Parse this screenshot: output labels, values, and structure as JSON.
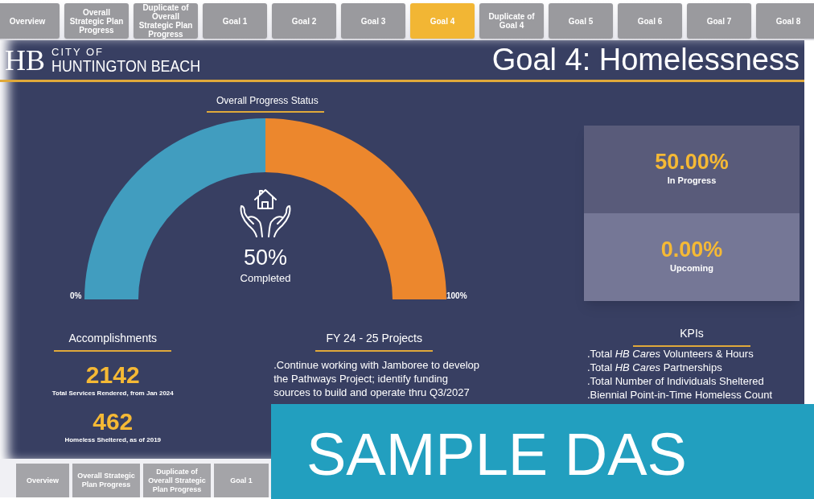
{
  "top_tabs": [
    {
      "label": "Overview",
      "selected": false
    },
    {
      "label": "Overall Strategic Plan Progress",
      "selected": false
    },
    {
      "label": "Duplicate of Overall Strategic Plan Progress",
      "selected": false
    },
    {
      "label": "Goal 1",
      "selected": false
    },
    {
      "label": "Goal 2",
      "selected": false
    },
    {
      "label": "Goal 3",
      "selected": false
    },
    {
      "label": "Goal 4",
      "selected": true
    },
    {
      "label": "Duplicate of Goal 4",
      "selected": false
    },
    {
      "label": "Goal 5",
      "selected": false
    },
    {
      "label": "Goal 6",
      "selected": false
    },
    {
      "label": "Goal 7",
      "selected": false
    },
    {
      "label": "Goal 8",
      "selected": false
    }
  ],
  "logo": {
    "mark": "HB",
    "small": "CITY OF",
    "large": "HUNTINGTON BEACH"
  },
  "title": "Goal 4: Homelessness",
  "gauge": {
    "title": "Overall Progress Status",
    "level": 0.5,
    "value": "50%",
    "caption": "Completed",
    "min_label": "0%",
    "max_label": "100%"
  },
  "status_cards": [
    {
      "value": "50.00%",
      "label": "In Progress"
    },
    {
      "value": "0.00%",
      "label": "Upcoming"
    }
  ],
  "accomplishments": {
    "title": "Accomplishments",
    "items": [
      {
        "value": "2142",
        "label": "Total Services Rendered, from Jan 2024"
      },
      {
        "value": "462",
        "label": "Homeless Sheltered, as of 2019"
      }
    ]
  },
  "projects": {
    "title": "FY 24 - 25 Projects",
    "items": [
      ".Continue working with Jamboree to develop the Pathways Project; identify funding sources to build and operate thru Q3/2027"
    ]
  },
  "kpis": {
    "title": "KPIs",
    "items": [
      ".Total *HB Cares* Volunteers & Hours",
      ".Total *HB Cares* Partnerships",
      ".Total Number of Individuals Sheltered",
      ".Biennial Point-in-Time Homeless Count"
    ]
  },
  "bottom_tabs": [
    {
      "label": "Overview"
    },
    {
      "label": "Overall Strategic Plan Progress"
    },
    {
      "label": "Duplicate of Overall Strategic Plan Progress"
    },
    {
      "label": "Goal 1"
    }
  ],
  "banner": "SAMPLE DAS"
}
